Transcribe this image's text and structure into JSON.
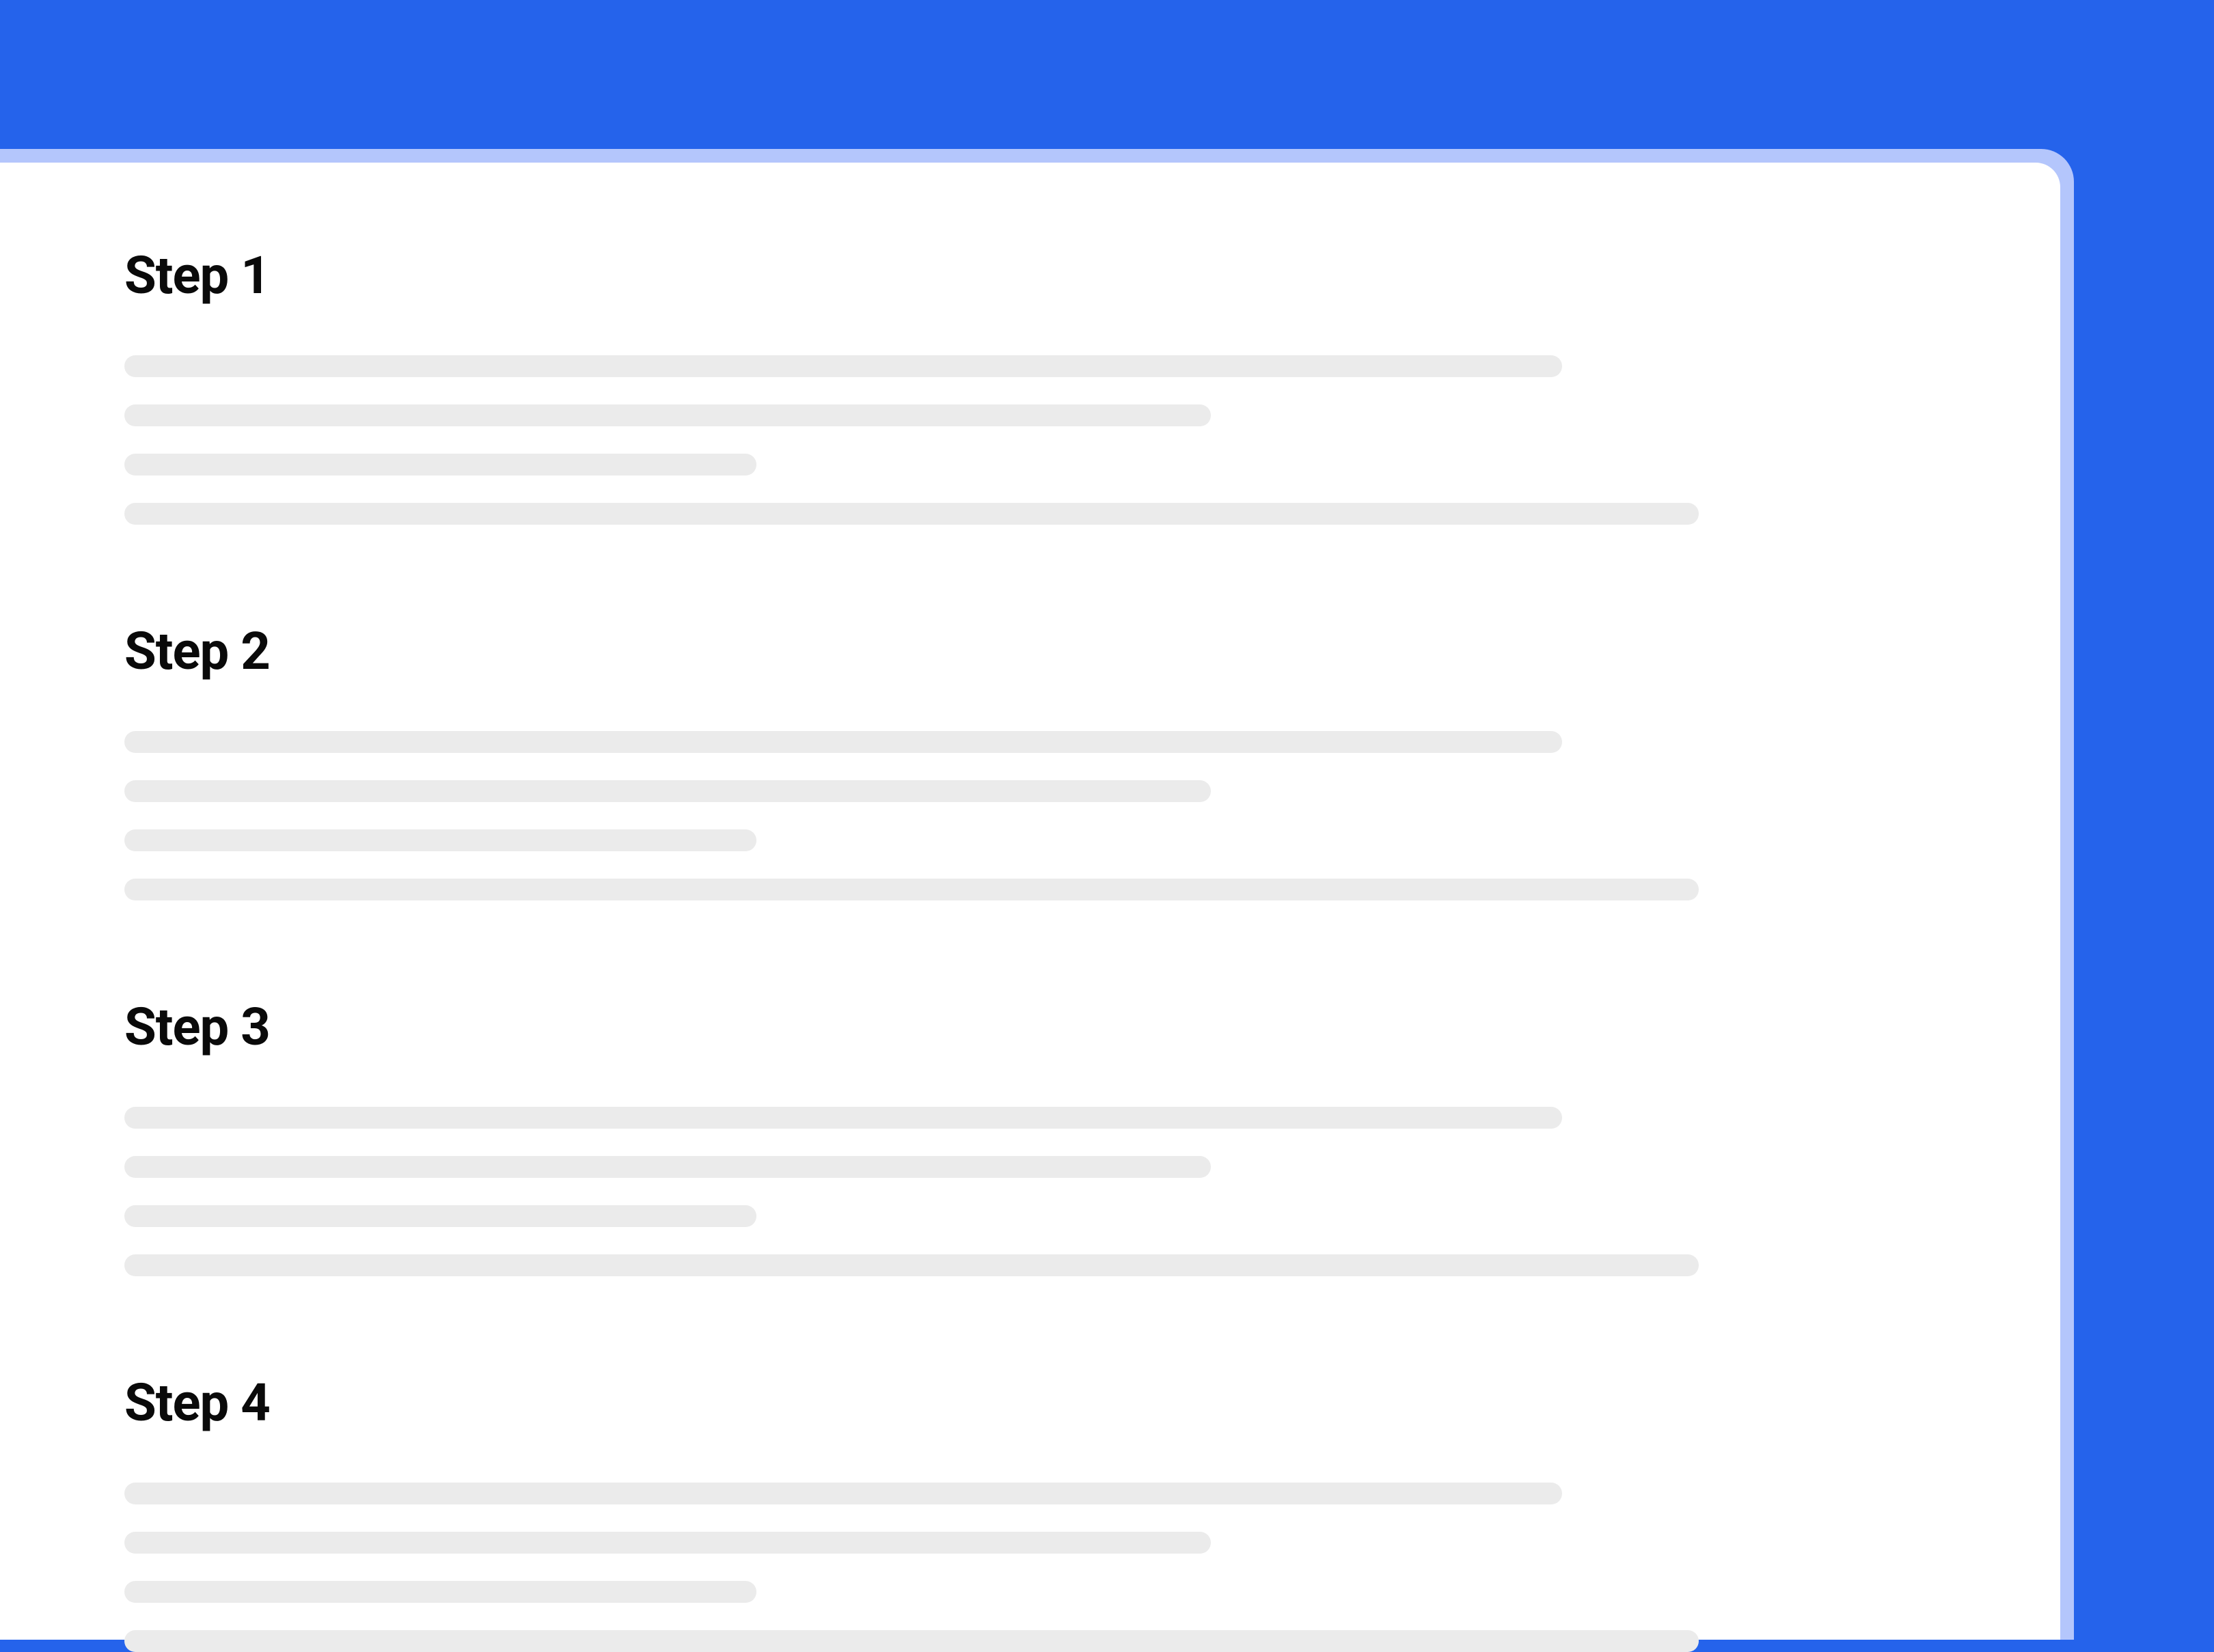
{
  "colors": {
    "background": "#2563EB",
    "card_border": "#B4C6FC",
    "card_bg": "#FFFFFF",
    "placeholder": "#EBEBEB",
    "heading": "#0A0A0A"
  },
  "steps": [
    {
      "title": "Step 1"
    },
    {
      "title": "Step 2"
    },
    {
      "title": "Step 3"
    },
    {
      "title": "Step 4"
    }
  ]
}
